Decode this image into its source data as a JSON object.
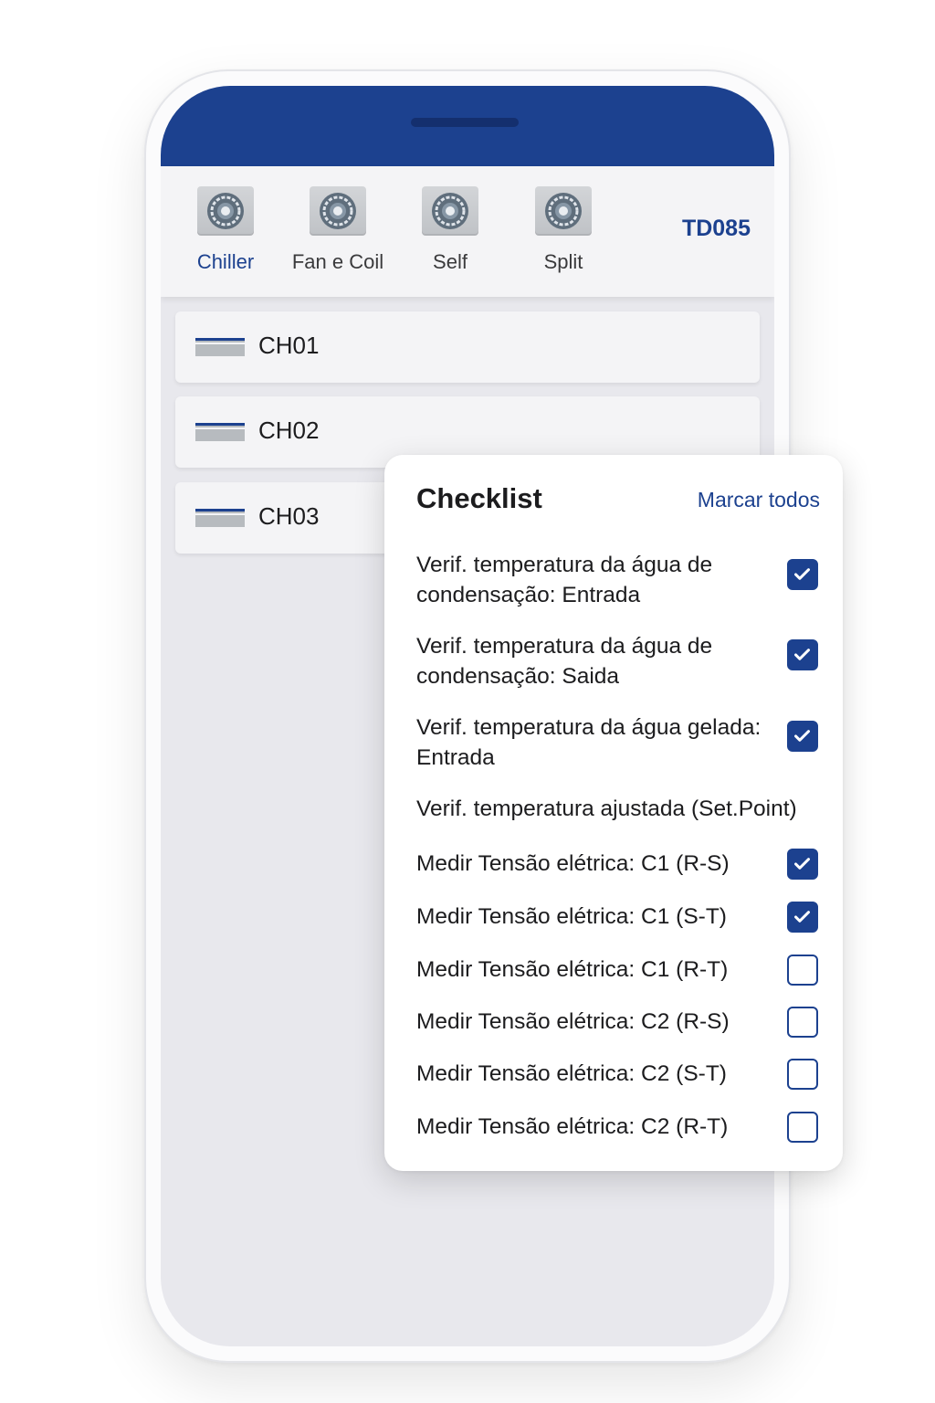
{
  "categories": [
    {
      "label": "Chiller",
      "icon": "fan-unit-icon",
      "active": true
    },
    {
      "label": "Fan e Coil",
      "icon": "fan-unit-icon",
      "active": false
    },
    {
      "label": "Self",
      "icon": "fan-unit-icon",
      "active": false
    },
    {
      "label": "Split",
      "icon": "fan-unit-icon",
      "active": false
    }
  ],
  "tag": "TD085",
  "units": [
    {
      "label": "CH01",
      "icon": "equipment-icon"
    },
    {
      "label": "CH02",
      "icon": "equipment-icon"
    },
    {
      "label": "CH03",
      "icon": "equipment-icon"
    }
  ],
  "checklist": {
    "title": "Checklist",
    "mark_all": "Marcar todos",
    "items": [
      {
        "text": "Verif. temperatura da água de condensação: Entrada",
        "checked": true,
        "has_checkbox": true
      },
      {
        "text": "Verif. temperatura da água de condensação: Saida",
        "checked": true,
        "has_checkbox": true
      },
      {
        "text": "Verif. temperatura da água gelada: Entrada",
        "checked": true,
        "has_checkbox": true
      },
      {
        "text": "Verif. temperatura ajustada (Set.Point)",
        "checked": false,
        "has_checkbox": false
      },
      {
        "text": "Medir Tensão elétrica: C1 (R-S)",
        "checked": true,
        "has_checkbox": true
      },
      {
        "text": "Medir Tensão elétrica: C1 (S-T)",
        "checked": true,
        "has_checkbox": true
      },
      {
        "text": "Medir Tensão elétrica: C1 (R-T)",
        "checked": false,
        "has_checkbox": true
      },
      {
        "text": "Medir Tensão elétrica: C2 (R-S)",
        "checked": false,
        "has_checkbox": true
      },
      {
        "text": "Medir Tensão elétrica: C2 (S-T)",
        "checked": false,
        "has_checkbox": true
      },
      {
        "text": "Medir Tensão elétrica: C2 (R-T)",
        "checked": false,
        "has_checkbox": true
      }
    ]
  },
  "colors": {
    "primary": "#1c418f",
    "background": "#e8e8ed"
  }
}
